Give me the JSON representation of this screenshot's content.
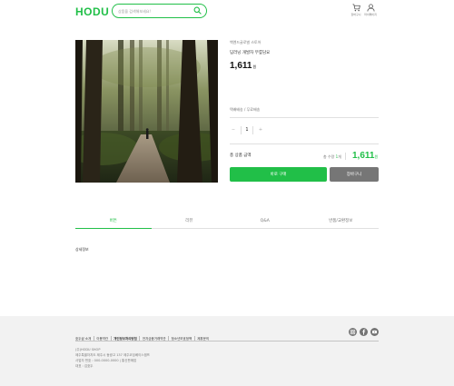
{
  "header": {
    "logo": "HODU",
    "search_placeholder": "상품을 검색해보세요!",
    "cart_label": "장바구니",
    "mypage_label": "마이페이지"
  },
  "product": {
    "seller": "백엔드글로벌 스토어",
    "name": "딥러닝 개발자 무릎담요",
    "price": "1,611",
    "price_unit": "원",
    "shipping": "택배배송 / 무료배송",
    "quantity": "1",
    "total_label": "총 상품 금액",
    "total_qty_prefix": "총 수량",
    "total_qty_value": "1",
    "total_qty_suffix": "개",
    "total_price": "1,611",
    "total_price_unit": "원",
    "buy_label": "바로 구매",
    "cart_label": "장바구니"
  },
  "tabs": [
    {
      "label": "버튼"
    },
    {
      "label": "리뷰"
    },
    {
      "label": "Q&A"
    },
    {
      "label": "반품/교환정보"
    }
  ],
  "tab_content": "상세정보",
  "footer": {
    "links": [
      "호두샵 소개",
      "이용약관",
      "개인정보처리방침",
      "전자금융거래약관",
      "청소년보호정책",
      "제휴문의"
    ],
    "bold_link_index": 2,
    "info": [
      "(주)HODU SHOP",
      "제주특별자치도 제주시 동광고 137 제주코딩베이스캠프",
      "사업자 번호 : 000-0000-0000 | 통신판매업",
      "대표 : 김호두"
    ]
  },
  "colors": {
    "accent": "#21bf48",
    "secondary_button": "#767676",
    "footer_bg": "#f2f2f2"
  },
  "icons": [
    "search-icon",
    "cart-icon",
    "user-icon",
    "instagram-icon",
    "facebook-icon",
    "youtube-icon"
  ]
}
